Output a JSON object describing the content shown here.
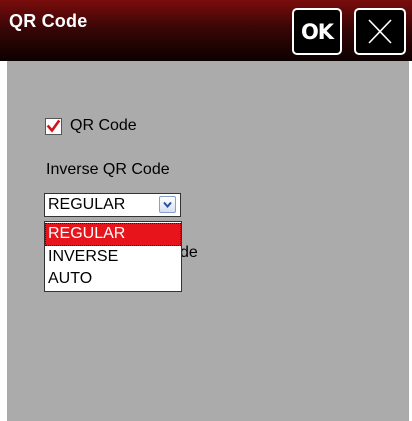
{
  "window": {
    "title": "QR Code",
    "ok_label": "OK"
  },
  "form": {
    "enable_checkbox": {
      "label": "QR Code",
      "checked": true
    },
    "inverse_field": {
      "label": "Inverse QR Code",
      "selected_value": "REGULAR",
      "options": [
        "REGULAR",
        "INVERSE",
        "AUTO"
      ],
      "highlighted_option": "REGULAR"
    },
    "obscured_label_fragment": "de"
  },
  "colors": {
    "titlebar": "#3a0606",
    "body_background": "#ababab",
    "highlight": "#e8141b",
    "checkmark": "#d0161c"
  },
  "icons": {
    "close": "close-x-icon",
    "check": "checkmark-icon",
    "dropdown": "chevron-down-icon"
  }
}
